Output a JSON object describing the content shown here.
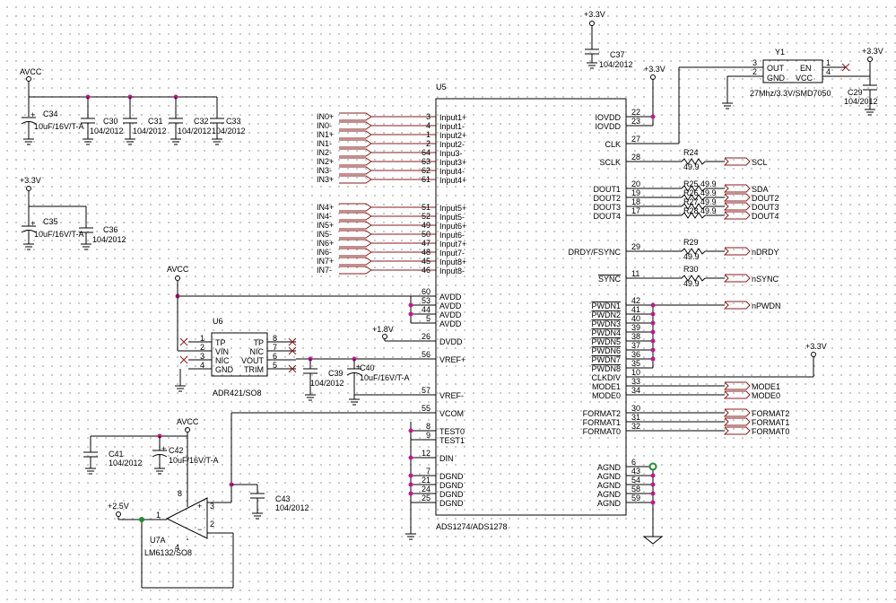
{
  "left_caps": {
    "avcc_label": "AVCC",
    "c34": "C34",
    "c34_val": "10uF/16V/T-A",
    "c30": "C30",
    "c30_val": "104/2012",
    "c31": "C31",
    "c31_val": "104/2012",
    "c32": "C32",
    "c32_val": "104/2012",
    "c33": "C33",
    "c33_val": "104/2012",
    "v33_label": "+3.3V",
    "c35": "C35",
    "c35_val": "10uF/16V/T-A",
    "c36": "C36",
    "c36_val": "104/2012"
  },
  "inputs_top": [
    "IN0+",
    "IN0-",
    "IN1+",
    "IN1-",
    "IN2-",
    "IN2+",
    "IN3-",
    "IN3+"
  ],
  "inputs_bottom": [
    "IN4+",
    "IN4-",
    "IN5+",
    "IN5-",
    "IN6+",
    "IN6-",
    "IN7+",
    "IN7-"
  ],
  "u5": {
    "ref": "U5",
    "part": "ADS1274/ADS1278",
    "left_pins": [
      {
        "num": "3",
        "name": "Input1+"
      },
      {
        "num": "4",
        "name": "Input1-"
      },
      {
        "num": "1",
        "name": "Input2+"
      },
      {
        "num": "2",
        "name": "Input2-"
      },
      {
        "num": "64",
        "name": "Inpu3-"
      },
      {
        "num": "63",
        "name": "Input3+"
      },
      {
        "num": "62",
        "name": "Input3+"
      },
      {
        "num": "61",
        "name": "Input4-"
      },
      {
        "num": "",
        "name": "Input4+"
      }
    ],
    "left_pins2": [
      {
        "num": "51",
        "name": "Input5+"
      },
      {
        "num": "52",
        "name": "Input5-"
      },
      {
        "num": "49",
        "name": "Input6+"
      },
      {
        "num": "50",
        "name": "Input6-"
      },
      {
        "num": "47",
        "name": "Input7+"
      },
      {
        "num": "48",
        "name": "Input7-"
      },
      {
        "num": "45",
        "name": "Input8+"
      },
      {
        "num": "46",
        "name": "Input8-"
      }
    ],
    "avdd_pins": [
      {
        "num": "60",
        "name": "AVDD"
      },
      {
        "num": "53",
        "name": "AVDD"
      },
      {
        "num": "44",
        "name": "AVDD"
      },
      {
        "num": "5",
        "name": "AVDD"
      }
    ],
    "dvdd_num": "26",
    "dvdd": "DVDD",
    "vrefp_num": "56",
    "vrefp": "VREF+",
    "vrefm_num": "57",
    "vrefm": "VREF-",
    "vcom_num": "55",
    "vcom": "VCOM",
    "test_pins": [
      {
        "num": "8",
        "name": "TEST0"
      },
      {
        "num": "9",
        "name": "TEST1"
      }
    ],
    "din_num": "12",
    "din": "DIN",
    "dgnd_pins": [
      {
        "num": "7",
        "name": "DGND"
      },
      {
        "num": "21",
        "name": "DGND"
      },
      {
        "num": "24",
        "name": "DGND"
      },
      {
        "num": "25",
        "name": "DGND"
      }
    ],
    "right_pins_top": [
      {
        "num": "22",
        "name": "IOVDD"
      },
      {
        "num": "23",
        "name": "IOVDD"
      },
      {
        "num": "27",
        "name": "CLK"
      },
      {
        "num": "28",
        "name": "SCLK"
      }
    ],
    "dout_pins": [
      {
        "num": "20",
        "name": "DOUT1"
      },
      {
        "num": "19",
        "name": "DOUT2"
      },
      {
        "num": "18",
        "name": "DOUT3"
      },
      {
        "num": "17",
        "name": "DOUT4"
      }
    ],
    "drdy_num": "29",
    "drdy": "DRDY/FSYNC",
    "sync_num": "11",
    "sync": "SYNC",
    "pwdn_pins": [
      {
        "num": "42",
        "name": "PWDN1"
      },
      {
        "num": "41",
        "name": "PWDN2"
      },
      {
        "num": "40",
        "name": "PWDN3"
      },
      {
        "num": "39",
        "name": "PWDN4"
      },
      {
        "num": "38",
        "name": "PWDN5"
      },
      {
        "num": "37",
        "name": "PWDN6"
      },
      {
        "num": "36",
        "name": "PWDN7"
      },
      {
        "num": "35",
        "name": "PWDN8"
      }
    ],
    "misc_pins": [
      {
        "num": "10",
        "name": "CLKDIV"
      },
      {
        "num": "33",
        "name": "MODE1"
      },
      {
        "num": "34",
        "name": "MODE0"
      }
    ],
    "format_pins": [
      {
        "num": "30",
        "name": "FORMAT2"
      },
      {
        "num": "31",
        "name": "FORMAT1"
      },
      {
        "num": "32",
        "name": "FORMAT0"
      }
    ],
    "agnd_pins": [
      {
        "num": "6",
        "name": "AGND"
      },
      {
        "num": "43",
        "name": "AGND"
      },
      {
        "num": "54",
        "name": "AGND"
      },
      {
        "num": "58",
        "name": "AGND"
      },
      {
        "num": "59",
        "name": "AGND"
      }
    ]
  },
  "resistors": [
    {
      "ref": "R24",
      "val": "49.9"
    },
    {
      "ref": "R25",
      "val": "49.9"
    },
    {
      "ref": "R26",
      "val": "49.9"
    },
    {
      "ref": "R27",
      "val": "49.9"
    },
    {
      "ref": "R28",
      "val": "49.9"
    },
    {
      "ref": "R29",
      "val": "49.9"
    },
    {
      "ref": "R30",
      "val": "49.9"
    }
  ],
  "out_ports": {
    "scl": "SCL",
    "sda": "SDA",
    "dout2": "DOUT2",
    "dout3": "DOUT3",
    "dout4": "DOUT4",
    "ndrdy": "nDRDY",
    "nsync": "nSYNC",
    "npwdn": "nPWDN",
    "mode1": "MODE1",
    "mode0": "MODE0",
    "format2": "FORMAT2",
    "format1": "FORMAT1",
    "format0": "FORMAT0"
  },
  "power": {
    "v33_a": "+3.3V",
    "v33_b": "+3.3V",
    "v33_c": "+3.3V",
    "v33_d": "+3.3V",
    "v18": "+1.8V",
    "avcc_u6": "AVCC",
    "avcc_u7": "AVCC",
    "v25": "+2.5V"
  },
  "c37": {
    "ref": "C37",
    "val": "104/2012"
  },
  "c29": {
    "ref": "C29",
    "val": "104/2012"
  },
  "y1": {
    "ref": "Y1",
    "part": "27Mhz/3.3V/SMD7050",
    "pins": {
      "p3": "3",
      "p2": "2",
      "p1": "1",
      "p4": "4"
    },
    "names": {
      "out": "OUT",
      "gnd": "GND",
      "en": "EN",
      "vcc": "VCC"
    }
  },
  "u6": {
    "ref": "U6",
    "part": "ADR421/SO8",
    "pins_left": [
      {
        "num": "1",
        "name": "TP"
      },
      {
        "num": "2",
        "name": "VIN"
      },
      {
        "num": "3",
        "name": "NIC"
      },
      {
        "num": "4",
        "name": "GND"
      }
    ],
    "pins_right": [
      {
        "num": "8",
        "name": "TP"
      },
      {
        "num": "7",
        "name": "NIC"
      },
      {
        "num": "6",
        "name": "VOUT"
      },
      {
        "num": "5",
        "name": "TRIM"
      }
    ]
  },
  "c39": {
    "ref": "C39",
    "val": "104/2012"
  },
  "c40": {
    "ref": "C40",
    "val": "10uF/16V/T-A"
  },
  "c41": {
    "ref": "C41",
    "val": "104/2012"
  },
  "c42": {
    "ref": "C42",
    "val": "10uF/16V/T-A"
  },
  "c43": {
    "ref": "C43",
    "val": "104/2012"
  },
  "u7": {
    "ref": "U7A",
    "part": "LM6132/SO8",
    "pin1": "1",
    "pin2": "2",
    "pin3": "3",
    "pin4": "4",
    "pin8": "8"
  }
}
